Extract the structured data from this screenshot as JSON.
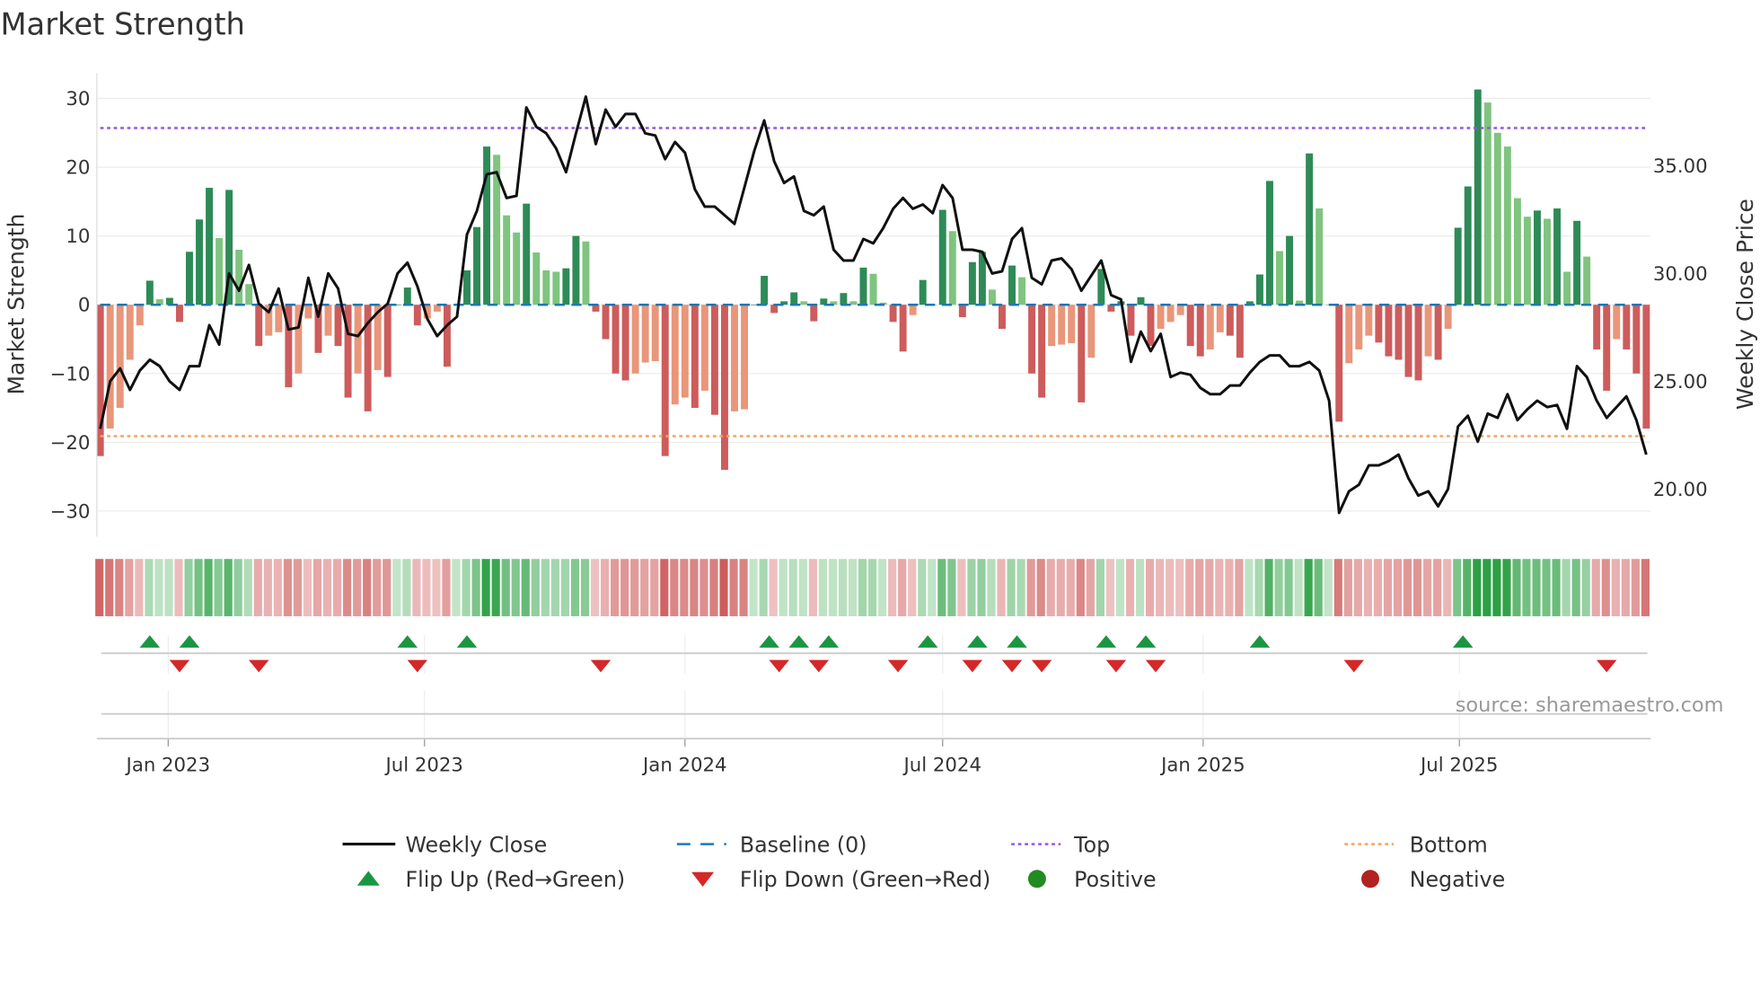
{
  "chart_data": {
    "type": "bar",
    "title": "Market Strength",
    "ylabel": "Market Strength",
    "y2label": "Weekly Close Price",
    "ylim": [
      -33.7,
      33.7
    ],
    "y2lim": [
      17.8,
      39.3
    ],
    "yticks": [
      30,
      20,
      10,
      0,
      -10,
      -20,
      -30
    ],
    "y2ticks": [
      "35.00",
      "30.00",
      "25.00",
      "20.00"
    ],
    "start_week": "2022-11-14",
    "frequency": "weekly",
    "xticks": [
      {
        "label": "Jan 2023",
        "date": "2023-01-01"
      },
      {
        "label": "Jul 2023",
        "date": "2023-07-01"
      },
      {
        "label": "Jan 2024",
        "date": "2024-01-01"
      },
      {
        "label": "Jul 2024",
        "date": "2024-07-01"
      },
      {
        "label": "Jan 2025",
        "date": "2025-01-01"
      },
      {
        "label": "Jul 2025",
        "date": "2025-07-01"
      }
    ],
    "strength": [
      -22,
      -18,
      -15,
      -8,
      -3,
      3.5,
      0.8,
      1,
      -2.5,
      7.7,
      12.4,
      17,
      9.7,
      16.7,
      8,
      3,
      -6,
      -4.5,
      -4,
      -12,
      -10,
      -2,
      -7,
      -4.5,
      -6,
      -13.5,
      -10,
      -15.5,
      -9.5,
      -10.5,
      0,
      2.5,
      -3,
      -2,
      -1,
      -9,
      0,
      5,
      11.3,
      23,
      21.8,
      13,
      10.5,
      14.7,
      7.6,
      5,
      4.8,
      5.3,
      10,
      9.2,
      -1,
      -5,
      -10,
      -11,
      -10,
      -8.4,
      -8.2,
      -22,
      -14.5,
      -13.5,
      -15,
      -12.5,
      -16,
      -24,
      -15.5,
      -15.2,
      0,
      4.2,
      -1.2,
      0.5,
      1.8,
      0.5,
      -2.4,
      0.9,
      0.5,
      1.7,
      0.5,
      5.4,
      4.5,
      0.3,
      -2.5,
      -6.8,
      -1.5,
      3.6,
      0,
      13.8,
      10.7,
      -1.8,
      6.2,
      7.7,
      2.2,
      -3.5,
      5.7,
      4,
      -10,
      -13.5,
      -6,
      -5.8,
      -5.6,
      -14.2,
      -7.7,
      5.2,
      -1,
      0.5,
      -4.5,
      1.1,
      -6,
      -3.5,
      -2.5,
      -1.5,
      -6,
      -7.5,
      -6.5,
      -4,
      -4.5,
      -7.7,
      0.5,
      4.4,
      18,
      7.8,
      10,
      0.6,
      22,
      14,
      0,
      -17,
      -8.5,
      -6.5,
      -4.5,
      -5.5,
      -7.5,
      -8,
      -10.5,
      -11,
      -7.5,
      -8,
      -3.5,
      11.2,
      17.2,
      31.3,
      29.4,
      25,
      23,
      15.5,
      12.8,
      13.7,
      12.5,
      14,
      4.8,
      12.2,
      7,
      -6.5,
      -12.5,
      -5,
      -6.5,
      -10,
      -18
    ],
    "weekly_close": [
      22.8,
      25,
      25.6,
      24.6,
      25.5,
      26,
      25.7,
      25,
      24.6,
      25.7,
      25.7,
      27.6,
      26.7,
      30,
      29.2,
      30.4,
      28.6,
      28.2,
      29.3,
      27.4,
      27.5,
      29.8,
      28,
      30,
      29.3,
      27.2,
      27.1,
      27.7,
      28.2,
      28.6,
      30,
      30.5,
      29.4,
      27.9,
      27.1,
      27.6,
      28,
      31.8,
      32.9,
      34.6,
      34.7,
      33.5,
      33.6,
      37.7,
      36.8,
      36.5,
      35.8,
      34.7,
      36.5,
      38.2,
      36,
      37.6,
      36.8,
      37.4,
      37.4,
      36.5,
      36.4,
      35.3,
      36.1,
      35.6,
      33.9,
      33.1,
      33.1,
      32.7,
      32.3,
      34,
      35.7,
      37.1,
      35.2,
      34.2,
      34.5,
      32.9,
      32.7,
      33.1,
      31.1,
      30.6,
      30.6,
      31.6,
      31.4,
      32.1,
      33,
      33.5,
      33,
      33.2,
      32.8,
      34.1,
      33.5,
      31.1,
      31.1,
      31,
      30,
      30.1,
      31.6,
      32.1,
      29.8,
      29.5,
      30.6,
      30.7,
      30.2,
      29.2,
      29.9,
      30.6,
      29,
      28.8,
      25.9,
      27.3,
      26.4,
      27.2,
      25.2,
      25.4,
      25.3,
      24.7,
      24.4,
      24.4,
      24.8,
      24.8,
      25.4,
      25.9,
      26.2,
      26.2,
      25.7,
      25.7,
      25.9,
      25.5,
      24.1,
      18.9,
      19.9,
      20.2,
      21.1,
      21.1,
      21.3,
      21.6,
      20.5,
      19.7,
      19.9,
      19.2,
      20,
      22.9,
      23.4,
      22.2,
      23.5,
      23.3,
      24.4,
      23.2,
      23.7,
      24.1,
      23.8,
      23.9,
      22.8,
      25.7,
      25.2,
      24.1,
      23.3,
      23.8,
      24.3,
      23.2,
      21.6
    ],
    "top_level": 25.7,
    "bottom_level": -19.1,
    "baseline": 0,
    "flip_up_weeks": [
      5,
      9,
      31,
      37,
      67.5,
      70.5,
      73.5,
      83.5,
      88.5,
      92.5,
      101.5,
      105.5,
      117,
      137.5
    ],
    "flip_down_weeks": [
      8,
      16,
      32,
      50.5,
      68.5,
      72.5,
      80.5,
      88,
      92,
      95,
      102.5,
      106.5,
      126.5,
      152
    ],
    "legend": {
      "placement": "bottom",
      "items": [
        {
          "key": "close",
          "label": "Weekly Close"
        },
        {
          "key": "baseline",
          "label": "Baseline (0)"
        },
        {
          "key": "top",
          "label": "Top"
        },
        {
          "key": "bottom",
          "label": "Bottom"
        },
        {
          "key": "flip_up",
          "label": "Flip Up (Red→Green)"
        },
        {
          "key": "flip_down",
          "label": "Flip Down (Green→Red)"
        },
        {
          "key": "positive",
          "label": "Positive"
        },
        {
          "key": "negative",
          "label": "Negative"
        }
      ]
    },
    "source": "source: sharemaestro.com",
    "colors": {
      "pos_up": "#2e8b57",
      "pos_down": "#7fc47f",
      "neg_down": "#cd5c5c",
      "neg_up": "#e9967a",
      "close": "#111111",
      "baseline": "#1f77b4",
      "top": "#9955dd",
      "bottom": "#f4a460",
      "flip_up": "#1a9641",
      "flip_down": "#d62728",
      "positive": "#228b22",
      "negative": "#b22222"
    }
  }
}
